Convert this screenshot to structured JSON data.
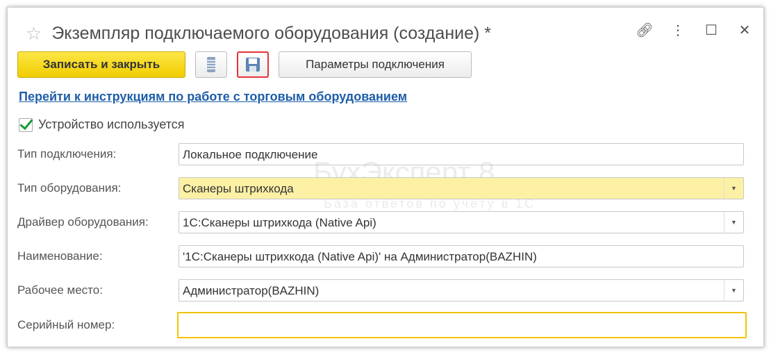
{
  "window": {
    "title": "Экземпляр подключаемого оборудования (создание) *"
  },
  "toolbar": {
    "save_close": "Записать и закрыть",
    "params": "Параметры подключения"
  },
  "link": "Перейти к инструкциям по работе с торговым оборудованием",
  "checkbox": {
    "label": "Устройство используется",
    "checked": true
  },
  "fields": [
    {
      "label": "Тип подключения:",
      "value": "Локальное подключение"
    },
    {
      "label": "Тип оборудования:",
      "value": "Сканеры штрихкода"
    },
    {
      "label": "Драйвер оборудования:",
      "value": "1С:Сканеры штрихкода (Native Api)"
    },
    {
      "label": "Наименование:",
      "value": "'1С:Сканеры штрихкода (Native Api)' на Администратор(BAZHIN)"
    },
    {
      "label": "Рабочее место:",
      "value": "Администратор(BAZHIN)"
    },
    {
      "label": "Серийный номер:",
      "value": ""
    }
  ],
  "watermark": {
    "name": "БухЭксперт 8",
    "tagline": "База ответов по учёту в 1С"
  }
}
